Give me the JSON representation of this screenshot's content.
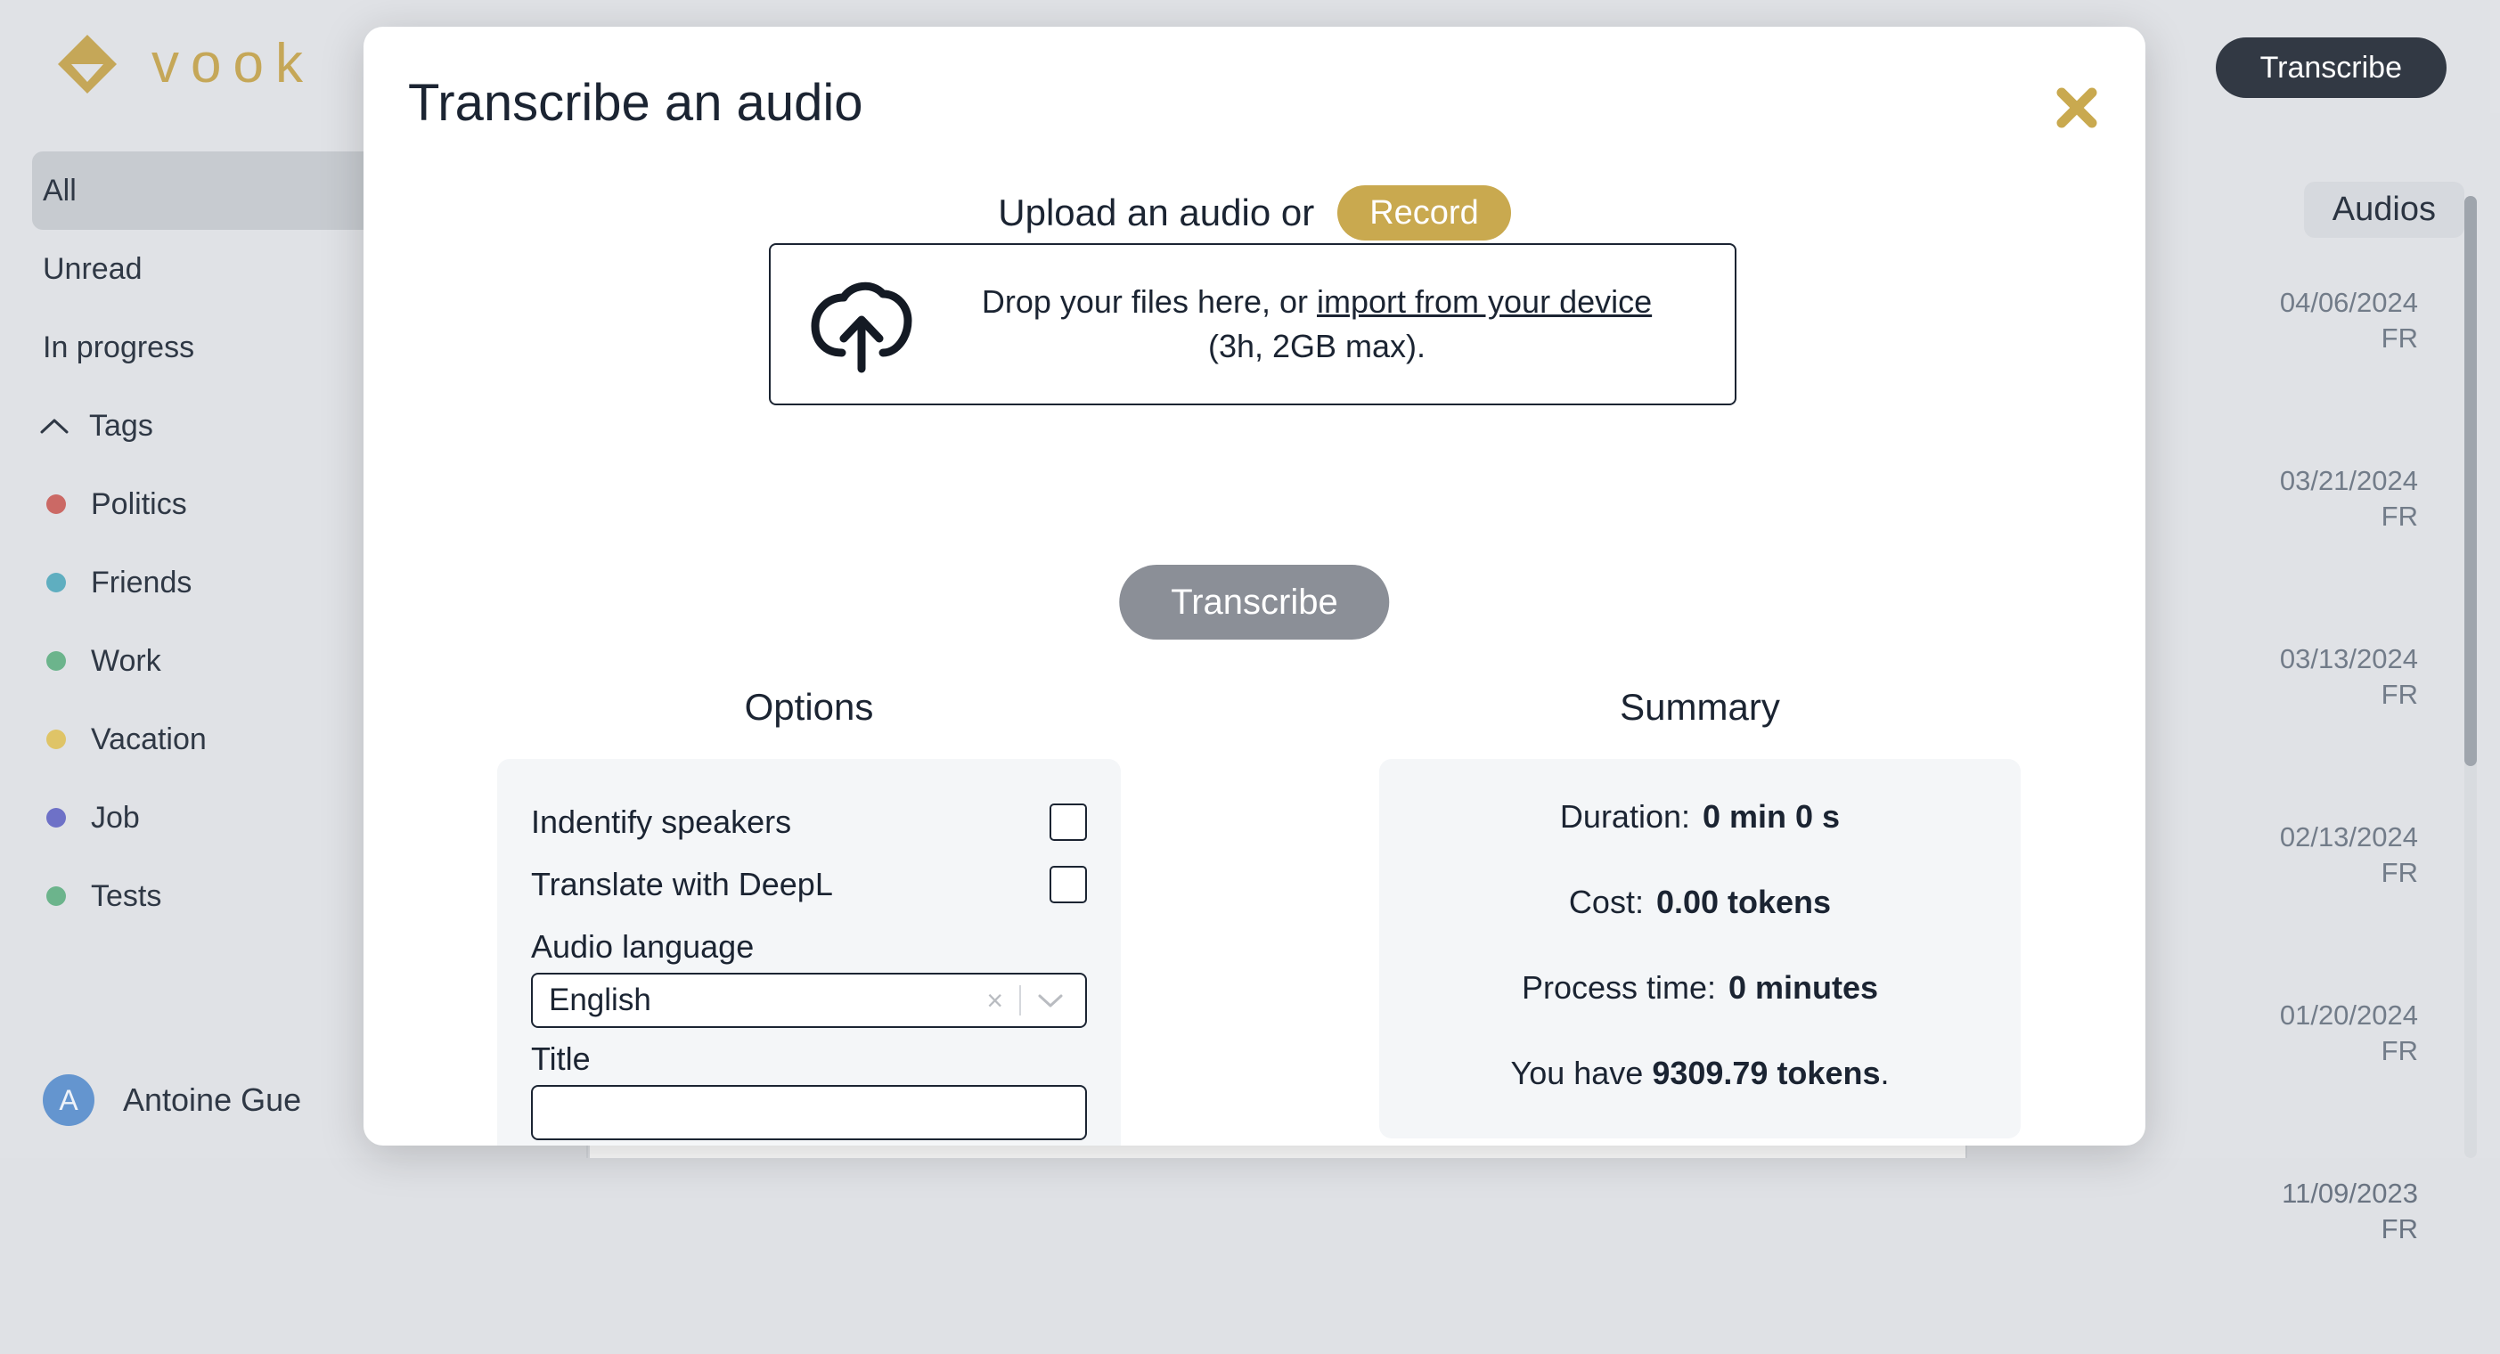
{
  "brand": {
    "word": "vook",
    "logo_icon": "diamond-logo-icon",
    "color": "#c2a24e"
  },
  "header": {
    "transcribe_label": "Transcribe"
  },
  "sidebar": {
    "items": [
      {
        "label": "All",
        "active": true
      },
      {
        "label": "Unread",
        "active": false
      },
      {
        "label": "In progress",
        "active": false
      }
    ],
    "tags_section": {
      "label": "Tags",
      "chevron_icon": "chevron-up-icon",
      "tags": [
        {
          "label": "Politics",
          "color": "#c8605c"
        },
        {
          "label": "Friends",
          "color": "#56a9bd"
        },
        {
          "label": "Work",
          "color": "#63b085"
        },
        {
          "label": "Vacation",
          "color": "#ddc15e"
        },
        {
          "label": "Job",
          "color": "#6569c4"
        },
        {
          "label": "Tests",
          "color": "#63b085"
        }
      ]
    },
    "user": {
      "initial": "A",
      "name": "Antoine Gue",
      "avatar_color": "#5b8fcc"
    }
  },
  "audios_panel": {
    "tab_label": "Audios",
    "rows": [
      {
        "date": "04/06/2024",
        "lang": "FR"
      },
      {
        "date": "03/21/2024",
        "lang": "FR"
      },
      {
        "date": "03/13/2024",
        "lang": "FR"
      },
      {
        "date": "02/13/2024",
        "lang": "FR"
      },
      {
        "date": "01/20/2024",
        "lang": "FR"
      },
      {
        "date": "11/09/2023",
        "lang": "FR"
      }
    ]
  },
  "modal": {
    "title": "Transcribe an audio",
    "close_icon": "close-icon",
    "upload": {
      "heading": "Upload an audio or",
      "record_label": "Record",
      "dropzone_icon": "cloud-upload-icon",
      "dropzone_text_before": "Drop your files here, or ",
      "dropzone_link": "import from your device",
      "dropzone_text_after": "(3h, 2GB max)."
    },
    "transcribe_label": "Transcribe",
    "options": {
      "heading": "Options",
      "checkboxes": [
        {
          "label": "Indentify speakers",
          "checked": false
        },
        {
          "label": "Translate with DeepL",
          "checked": false
        }
      ],
      "language_label": "Audio language",
      "language_value": "English",
      "language_clear_icon": "clear-x-icon",
      "language_chevron_icon": "chevron-down-icon",
      "title_label": "Title",
      "title_value": "",
      "title_placeholder": ""
    },
    "summary": {
      "heading": "Summary",
      "rows": [
        {
          "label": "Duration:",
          "value": "0 min 0 s"
        },
        {
          "label": "Cost:",
          "value": "0.00 tokens"
        },
        {
          "label": "Process time:",
          "value": "0 minutes"
        }
      ],
      "balance_before": "You have ",
      "balance_value": "9309.79 tokens",
      "balance_after": "."
    }
  }
}
